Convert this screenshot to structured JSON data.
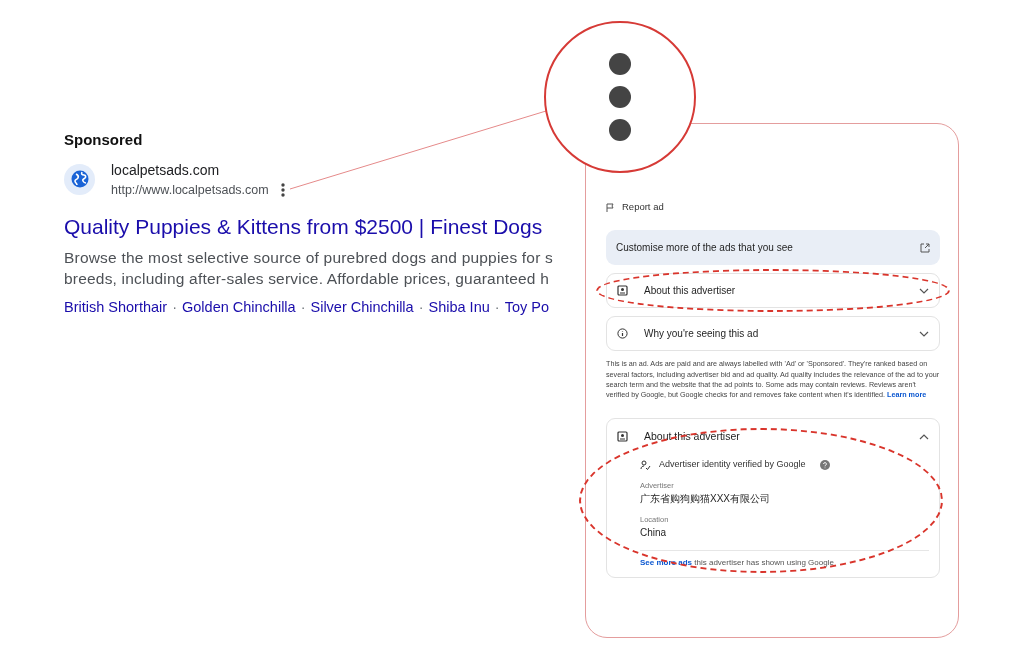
{
  "ad": {
    "label": "Sponsored",
    "site_name": "localpetsads.com",
    "url": "http://www.localpetsads.com",
    "title": "Quality Puppies & Kittens from $2500 | Finest Dogs",
    "description": [
      "Browse the most selective source of purebred dogs and puppies for s",
      "breeds, including after-sales service. Affordable prices, guaranteed h"
    ],
    "separator": "·",
    "sitelinks": [
      "British Shorthair",
      "Golden Chinchilla",
      "Silver Chinchilla",
      "Shiba Inu",
      "Toy Po"
    ]
  },
  "panel": {
    "report": "Report ad",
    "customise": "Customise more of the ads that you see",
    "sections": [
      {
        "title": "About this advertiser",
        "expanded": false,
        "highlighted": true
      },
      {
        "title": "Why you're seeing this ad",
        "expanded": false,
        "highlighted": false
      }
    ],
    "disclosure": "This is an ad. Ads are paid and are always labelled with 'Ad' or 'Sponsored'. They're ranked based on several factors, including advertiser bid and ad quality. Ad quality includes the relevance of the ad to your search term and the website that the ad points to. Some ads may contain reviews. Reviews aren't verified by Google, but Google checks for and removes fake content when it's identified.",
    "disclosure_link": "Learn more",
    "advertiser": {
      "title": "About this advertiser",
      "expanded": true,
      "highlighted": true,
      "verified": "Advertiser identity verified by Google",
      "fields": [
        {
          "label": "Advertiser",
          "value": "广东省购狗购猫XXX有限公司"
        },
        {
          "label": "Location",
          "value": "China"
        }
      ],
      "footer_link": "See more ads",
      "footer_text": "this advertiser has shown using Google"
    }
  }
}
